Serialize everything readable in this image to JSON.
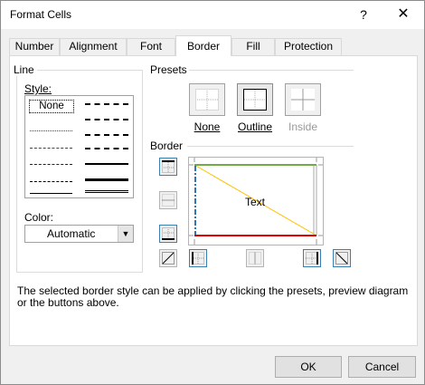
{
  "window": {
    "title": "Format Cells",
    "help": "?",
    "close": "✕"
  },
  "tabs": [
    {
      "label": "Number"
    },
    {
      "label": "Alignment"
    },
    {
      "label": "Font"
    },
    {
      "label": "Border"
    },
    {
      "label": "Fill"
    },
    {
      "label": "Protection"
    }
  ],
  "line": {
    "group_label": "Line",
    "style_label": "Style:",
    "none_label": "None",
    "color_label": "Color:",
    "color_value": "Automatic"
  },
  "presets": {
    "label": "Presets",
    "none": "None",
    "outline": "Outline",
    "inside": "Inside"
  },
  "border": {
    "label": "Border",
    "preview_text": "Text",
    "colors": {
      "top": "#70ad47",
      "bottom": "#e00000",
      "diagonal": "#ffc000",
      "left": "#2e75b6"
    }
  },
  "info_text": "The selected border style can be applied by clicking the presets, preview diagram or the buttons  above.",
  "buttons": {
    "ok": "OK",
    "cancel": "Cancel"
  }
}
